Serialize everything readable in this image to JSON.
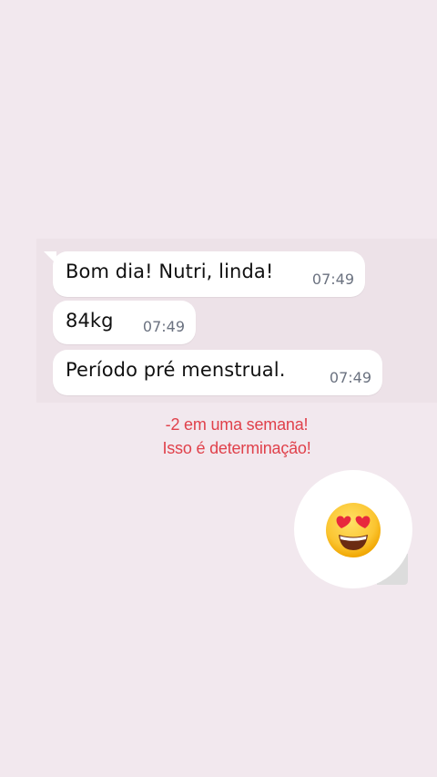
{
  "messages": [
    {
      "text": "Bom dia! Nutri, linda!",
      "time": "07:49"
    },
    {
      "text": "84kg",
      "time": "07:49"
    },
    {
      "text": "Período pré menstrual.",
      "time": "07:49"
    }
  ],
  "caption": {
    "line1": "-2 em uma semana!",
    "line2": "Isso é determinação!"
  },
  "sticker": {
    "icon": "heart-eyes-emoji-icon"
  },
  "colors": {
    "background": "#f2e8ee",
    "bubble": "#ffffff",
    "caption": "#e0414b",
    "time": "#6b7280"
  }
}
